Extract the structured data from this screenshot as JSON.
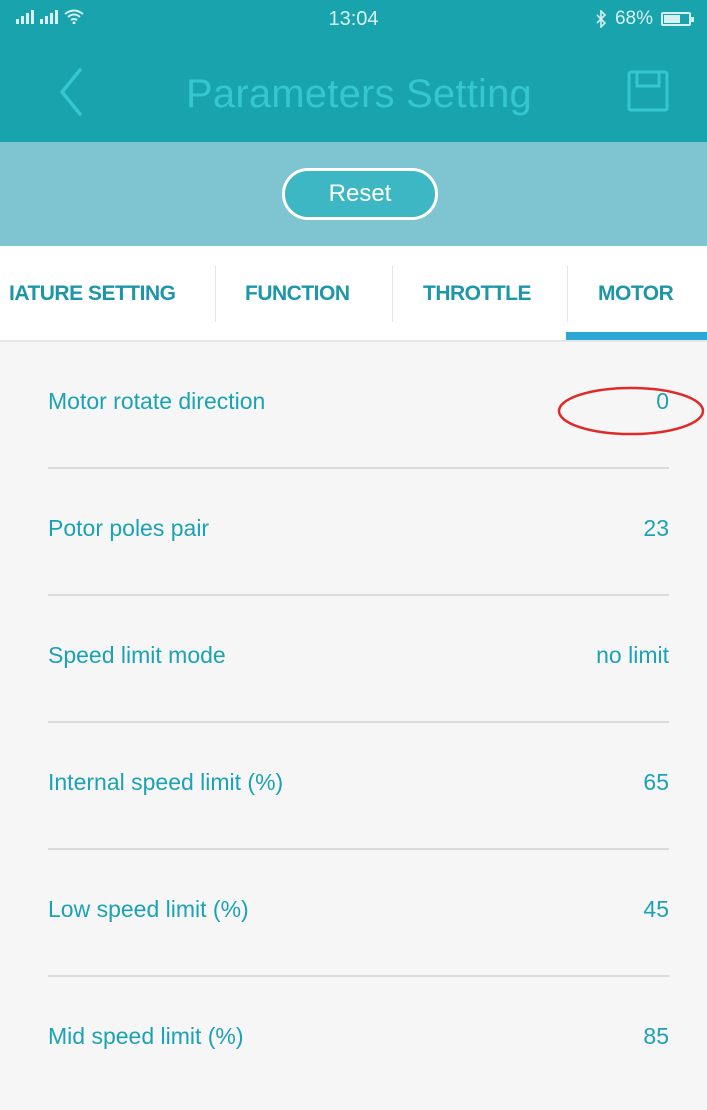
{
  "status_bar": {
    "time": "13:04",
    "bluetooth_icon": "bluetooth-icon",
    "battery_percent_text": "68%",
    "battery_level": 0.68,
    "signal_icon": "signal-icon",
    "wifi_icon": "wifi-icon"
  },
  "header": {
    "title": "Parameters Setting",
    "back_icon": "chevron-left-icon",
    "save_icon": "save-icon"
  },
  "toolbar": {
    "reset_label": "Reset"
  },
  "tabs": [
    {
      "label": "IATURE SETTING",
      "active": false
    },
    {
      "label": "FUNCTION",
      "active": false
    },
    {
      "label": "THROTTLE",
      "active": false
    },
    {
      "label": "MOTOR",
      "active": true
    }
  ],
  "params": [
    {
      "label": "Motor rotate direction",
      "value": "0",
      "highlighted": true
    },
    {
      "label": "Potor poles pair",
      "value": "23",
      "highlighted": false
    },
    {
      "label": "Speed limit mode",
      "value": "no limit",
      "highlighted": false
    },
    {
      "label": "Internal speed limit (%)",
      "value": "65",
      "highlighted": false
    },
    {
      "label": "Low speed limit (%)",
      "value": "45",
      "highlighted": false
    },
    {
      "label": "Mid speed limit (%)",
      "value": "85",
      "highlighted": false
    }
  ],
  "colors": {
    "header_bg": "#19a3ad",
    "reset_band_bg": "#7ec5d1",
    "accent_text": "#1ca2b5",
    "tab_underline": "#2aa7d3",
    "annotation_circle": "#e02a2a"
  }
}
